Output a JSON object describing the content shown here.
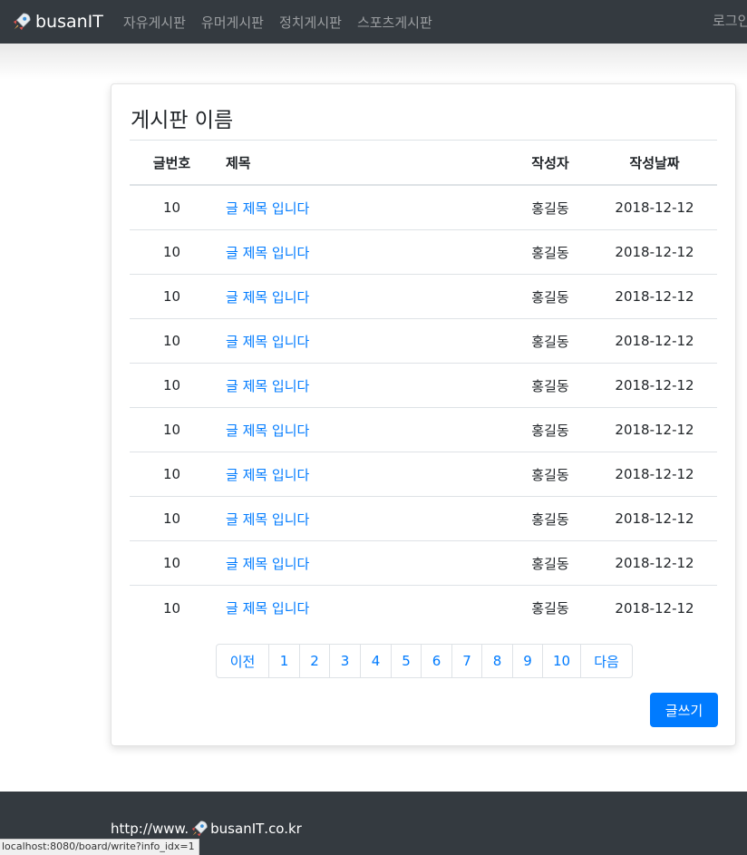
{
  "navbar": {
    "brand": "busanIT",
    "brand_icon": "rocket-icon",
    "links": [
      "자유게시판",
      "유머게시판",
      "정치게시판",
      "스포츠게시판"
    ],
    "login": "로그인"
  },
  "board": {
    "title": "게시판 이름",
    "columns": {
      "num": "글번호",
      "title": "제목",
      "writer": "작성자",
      "date": "작성날짜"
    },
    "rows": [
      {
        "num": "10",
        "title": "글 제목 입니다",
        "writer": "홍길동",
        "date": "2018-12-12"
      },
      {
        "num": "10",
        "title": "글 제목 입니다",
        "writer": "홍길동",
        "date": "2018-12-12"
      },
      {
        "num": "10",
        "title": "글 제목 입니다",
        "writer": "홍길동",
        "date": "2018-12-12"
      },
      {
        "num": "10",
        "title": "글 제목 입니다",
        "writer": "홍길동",
        "date": "2018-12-12"
      },
      {
        "num": "10",
        "title": "글 제목 입니다",
        "writer": "홍길동",
        "date": "2018-12-12"
      },
      {
        "num": "10",
        "title": "글 제목 입니다",
        "writer": "홍길동",
        "date": "2018-12-12"
      },
      {
        "num": "10",
        "title": "글 제목 입니다",
        "writer": "홍길동",
        "date": "2018-12-12"
      },
      {
        "num": "10",
        "title": "글 제목 입니다",
        "writer": "홍길동",
        "date": "2018-12-12"
      },
      {
        "num": "10",
        "title": "글 제목 입니다",
        "writer": "홍길동",
        "date": "2018-12-12"
      },
      {
        "num": "10",
        "title": "글 제목 입니다",
        "writer": "홍길동",
        "date": "2018-12-12"
      }
    ]
  },
  "pagination": {
    "prev": "이전",
    "pages": [
      "1",
      "2",
      "3",
      "4",
      "5",
      "6",
      "7",
      "8",
      "9",
      "10"
    ],
    "next": "다음"
  },
  "actions": {
    "write": "글쓰기"
  },
  "footer": {
    "prefix": "http://www.",
    "brand": "busanIT",
    "suffix": ".co.kr"
  },
  "status_bar": {
    "url": "localhost:8080/board/write?info_idx=1"
  },
  "colors": {
    "navbar": "#343a40",
    "link": "#007bff",
    "button": "#007bff",
    "footer": "#343a40"
  }
}
